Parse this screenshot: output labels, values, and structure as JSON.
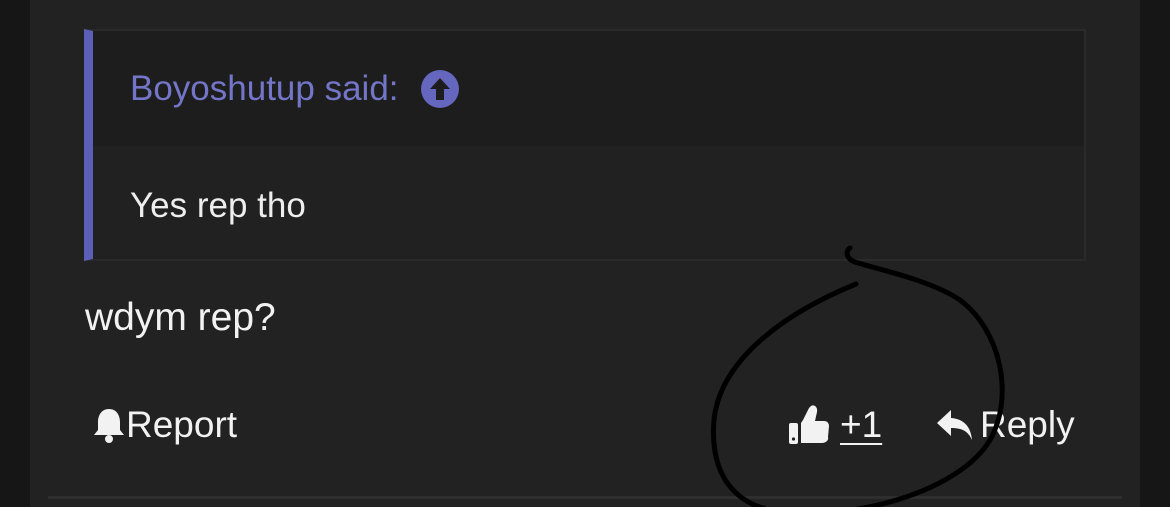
{
  "quote": {
    "author": "Boyoshutup said:",
    "jump_icon": "arrow-up-circle-icon",
    "text": "Yes rep tho"
  },
  "post": {
    "message": "wdym rep?"
  },
  "actions": {
    "report_label": "Report",
    "report_icon": "bell-icon",
    "like_count": "+1",
    "like_icon": "thumbs-up-icon",
    "reply_label": "Reply",
    "reply_icon": "reply-arrow-icon"
  },
  "colors": {
    "accent": "#5c5fb6",
    "author_text": "#7376c8",
    "text": "#f2f2f2",
    "annotation": "#000000"
  }
}
